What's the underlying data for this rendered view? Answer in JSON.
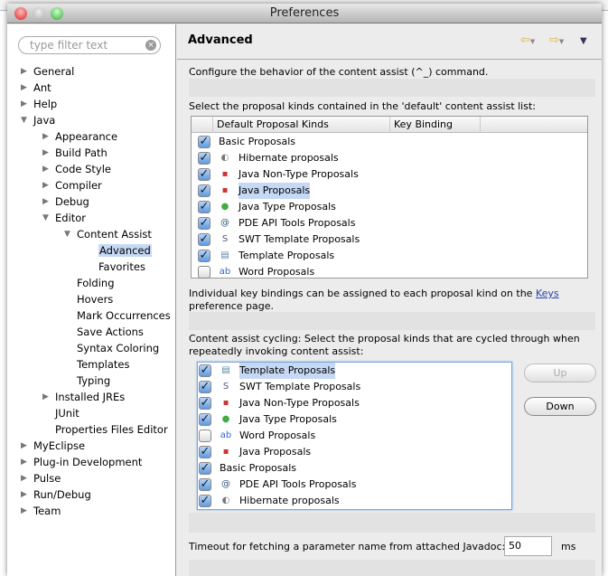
{
  "window": {
    "title": "Preferences"
  },
  "filter": {
    "placeholder": "type filter text"
  },
  "tree": [
    {
      "label": "General",
      "level": 0,
      "state": "collapsed"
    },
    {
      "label": "Ant",
      "level": 0,
      "state": "collapsed"
    },
    {
      "label": "Help",
      "level": 0,
      "state": "collapsed"
    },
    {
      "label": "Java",
      "level": 0,
      "state": "expanded"
    },
    {
      "label": "Appearance",
      "level": 1,
      "state": "collapsed"
    },
    {
      "label": "Build Path",
      "level": 1,
      "state": "collapsed"
    },
    {
      "label": "Code Style",
      "level": 1,
      "state": "collapsed"
    },
    {
      "label": "Compiler",
      "level": 1,
      "state": "collapsed"
    },
    {
      "label": "Debug",
      "level": 1,
      "state": "collapsed"
    },
    {
      "label": "Editor",
      "level": 1,
      "state": "expanded"
    },
    {
      "label": "Content Assist",
      "level": 2,
      "state": "expanded"
    },
    {
      "label": "Advanced",
      "level": 3,
      "state": "leaf",
      "selected": true
    },
    {
      "label": "Favorites",
      "level": 3,
      "state": "leaf"
    },
    {
      "label": "Folding",
      "level": 2,
      "state": "leaf"
    },
    {
      "label": "Hovers",
      "level": 2,
      "state": "leaf"
    },
    {
      "label": "Mark Occurrences",
      "level": 2,
      "state": "leaf"
    },
    {
      "label": "Save Actions",
      "level": 2,
      "state": "leaf"
    },
    {
      "label": "Syntax Coloring",
      "level": 2,
      "state": "leaf"
    },
    {
      "label": "Templates",
      "level": 2,
      "state": "leaf"
    },
    {
      "label": "Typing",
      "level": 2,
      "state": "leaf"
    },
    {
      "label": "Installed JREs",
      "level": 1,
      "state": "collapsed"
    },
    {
      "label": "JUnit",
      "level": 1,
      "state": "leaf"
    },
    {
      "label": "Properties Files Editor",
      "level": 1,
      "state": "leaf"
    },
    {
      "label": "MyEclipse",
      "level": 0,
      "state": "collapsed"
    },
    {
      "label": "Plug-in Development",
      "level": 0,
      "state": "collapsed"
    },
    {
      "label": "Pulse",
      "level": 0,
      "state": "collapsed"
    },
    {
      "label": "Run/Debug",
      "level": 0,
      "state": "collapsed"
    },
    {
      "label": "Team",
      "level": 0,
      "state": "collapsed"
    }
  ],
  "page": {
    "title": "Advanced",
    "description": "Configure the behavior of the content assist (^_) command.",
    "default_list_label": "Select the proposal kinds contained in the 'default' content assist list:",
    "columns": [
      "Default Proposal Kinds",
      "Key Binding"
    ],
    "default_list": [
      {
        "label": "Basic Proposals",
        "checked": true,
        "icon": ""
      },
      {
        "label": "Hibernate proposals",
        "checked": true,
        "icon": "hibernate-icon"
      },
      {
        "label": "Java Non-Type Proposals",
        "checked": true,
        "icon": "java-nontype-icon"
      },
      {
        "label": "Java Proposals",
        "checked": true,
        "icon": "java-icon",
        "selected": true
      },
      {
        "label": "Java Type Proposals",
        "checked": true,
        "icon": "java-type-icon"
      },
      {
        "label": "PDE API Tools Proposals",
        "checked": true,
        "icon": "pde-api-icon"
      },
      {
        "label": "SWT Template Proposals",
        "checked": true,
        "icon": "swt-icon"
      },
      {
        "label": "Template Proposals",
        "checked": true,
        "icon": "template-icon"
      },
      {
        "label": "Word Proposals",
        "checked": false,
        "icon": "word-icon"
      }
    ],
    "keys_note_pre": "Individual key bindings can be assigned to each proposal kind on the ",
    "keys_link": "Keys",
    "keys_note_post": "preference page.",
    "cycling_label_1": "Content assist cycling: Select the proposal kinds that are cycled through when",
    "cycling_label_2": "repeatedly invoking content assist:",
    "cycling_list": [
      {
        "label": "Template Proposals",
        "checked": true,
        "icon": "template-icon",
        "selected": true
      },
      {
        "label": "SWT Template Proposals",
        "checked": true,
        "icon": "swt-icon"
      },
      {
        "label": "Java Non-Type Proposals",
        "checked": true,
        "icon": "java-nontype-icon"
      },
      {
        "label": "Java Type Proposals",
        "checked": true,
        "icon": "java-type-icon"
      },
      {
        "label": "Word Proposals",
        "checked": false,
        "icon": "word-icon"
      },
      {
        "label": "Java Proposals",
        "checked": true,
        "icon": "java-icon"
      },
      {
        "label": "Basic Proposals",
        "checked": true,
        "icon": ""
      },
      {
        "label": "PDE API Tools Proposals",
        "checked": true,
        "icon": "pde-api-icon"
      },
      {
        "label": "Hibernate proposals",
        "checked": true,
        "icon": "hibernate-icon"
      }
    ],
    "up_label": "Up",
    "down_label": "Down",
    "timeout_label": "Timeout for fetching a parameter name from attached Javadoc:",
    "timeout_value": "50",
    "timeout_unit": "ms"
  }
}
